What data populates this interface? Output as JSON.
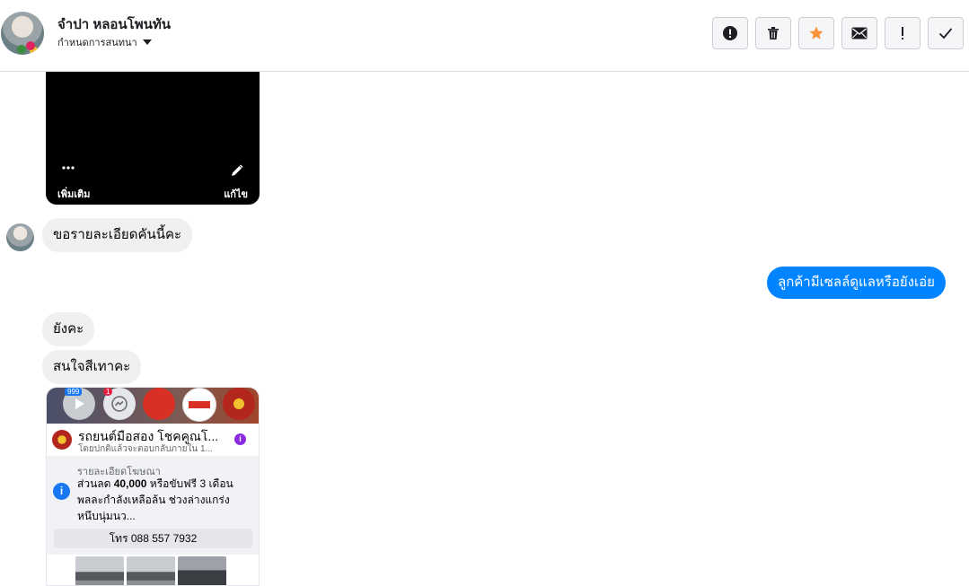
{
  "header": {
    "contact_name": "จำปา หลอนโพนทัน",
    "assign_label": "กำหนดการสนทนา",
    "actions": [
      {
        "name": "report-button",
        "icon": "alert-octagon-icon"
      },
      {
        "name": "delete-button",
        "icon": "trash-icon"
      },
      {
        "name": "star-button",
        "icon": "star-icon"
      },
      {
        "name": "mark-unread-button",
        "icon": "envelope-icon"
      },
      {
        "name": "important-button",
        "icon": "exclamation-icon"
      },
      {
        "name": "mark-done-button",
        "icon": "check-icon"
      }
    ]
  },
  "video_card": {
    "more_label": "เพิ่มเติม",
    "edit_label": "แก้ไข"
  },
  "messages": {
    "in_1": "ขอรายละเอียดคันนี้คะ",
    "out_1": "ลูกค้ามีเซลล์ดูแลหรือยังเอ่ย",
    "in_2": "ยังคะ",
    "in_3": "สนใจสีเทาคะ"
  },
  "post_card": {
    "title": "รถยนต์มือสอง โชคคูณโ...",
    "subtitle": "โดยปกติแล้วจะตอบกลับภายใน 1...",
    "details_label": "รายละเอียดโฆษณา",
    "body_line1_pre": "ส่วนลด ",
    "body_line1_bold": "40,000",
    "body_line1_post": " หรือขับฟรี 3 เดือน",
    "body_line2": "พลละกำลังเหลือล้น ช่วงล่างแกร่ง",
    "body_line3": "หนึบนุ่มนว...",
    "phone_button": "โทร 088 557 7932",
    "top_badge": "999",
    "top_badge2": "1"
  },
  "colors": {
    "accent_blue": "#0084ff",
    "star_orange": "#f7923a",
    "incoming_bubble": "#f0f0f0"
  }
}
